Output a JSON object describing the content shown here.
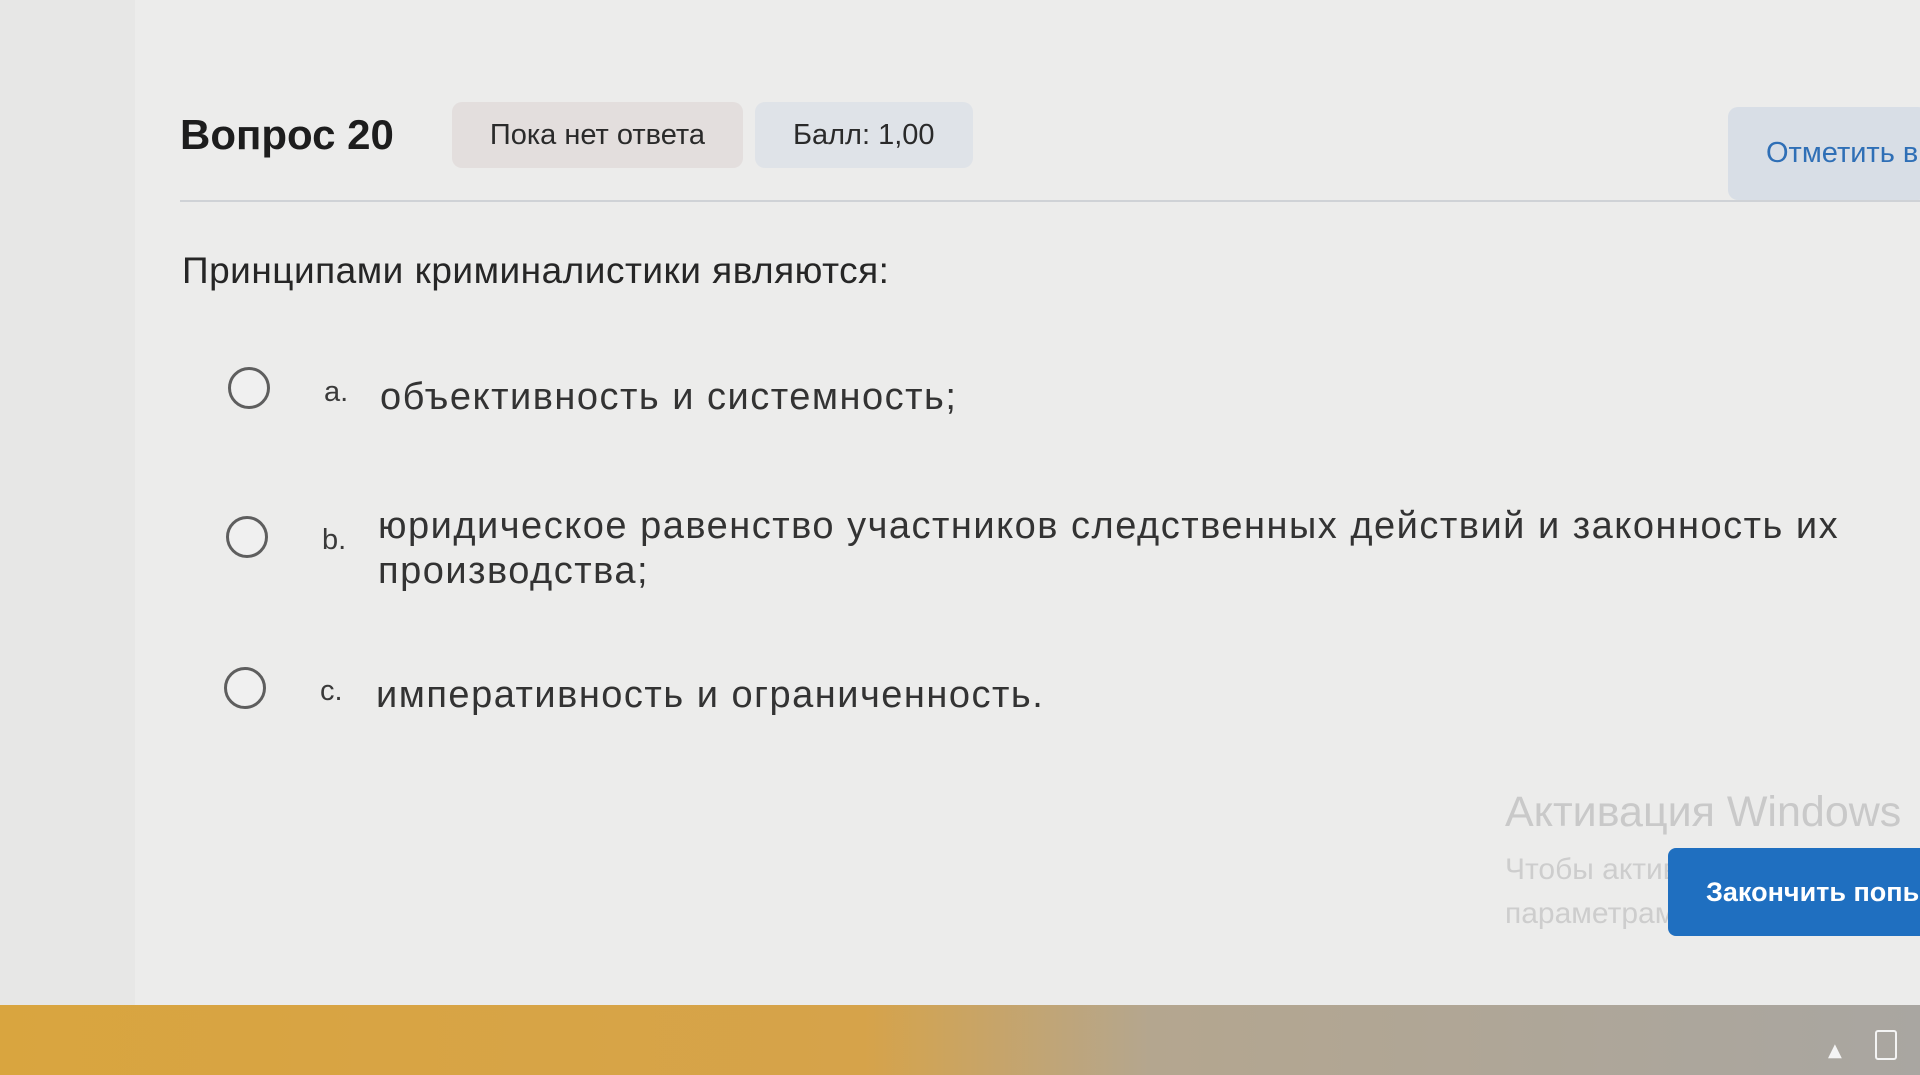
{
  "question": {
    "title": "Вопрос 20",
    "status_badge": "Пока нет ответа",
    "score_badge": "Балл: 1,00",
    "flag_label": "Отметить в",
    "text": "Принципами криминалистики являются:"
  },
  "options": [
    {
      "letter": "a.",
      "text": "объективность и системность;"
    },
    {
      "letter": "b.",
      "text_line1": "юридическое равенство участников следственных действий и законность их",
      "text_line2": "производства;"
    },
    {
      "letter": "c.",
      "text": "императивность и ограниченность."
    }
  ],
  "watermark": {
    "title": "Активация Windows",
    "line1": "Чтобы активировать Windo",
    "line2": "параметрам компьютера."
  },
  "finish_label": "Закончить попы",
  "colors": {
    "accent": "#1f6fc0",
    "flag_text": "#2f6fb6",
    "taskbar": "#d9a53f"
  },
  "icons": {
    "tray_device": "tablet-icon",
    "tray_arrow": "chevron-up-icon"
  }
}
